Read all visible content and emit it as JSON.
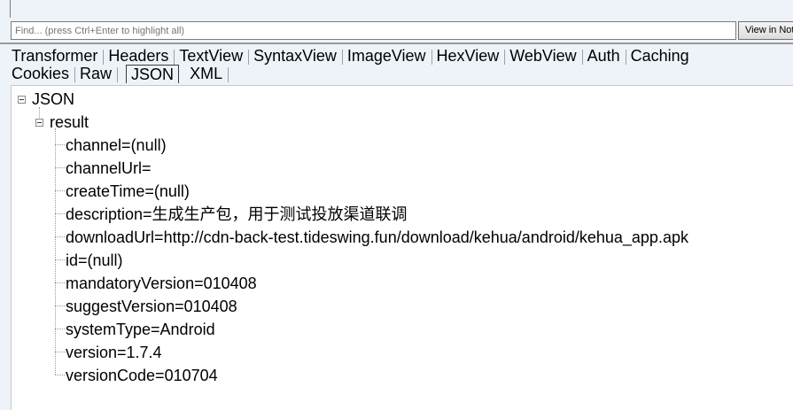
{
  "find": {
    "placeholder": "Find... (press Ctrl+Enter to highlight all)",
    "view_button": "View in Notepad"
  },
  "tabs": {
    "row1": [
      "Transformer",
      "Headers",
      "TextView",
      "SyntaxView",
      "ImageView",
      "HexView",
      "WebView",
      "Auth",
      "Caching"
    ],
    "row2": [
      "Cookies",
      "Raw",
      "JSON",
      "XML"
    ],
    "active": "JSON"
  },
  "tree": {
    "root": "JSON",
    "result": "result",
    "items": [
      "channel=(null)",
      "channelUrl=",
      "createTime=(null)",
      "description=生成生产包，用于测试投放渠道联调",
      "downloadUrl=http://cdn-back-test.tideswing.fun/download/kehua/android/kehua_app.apk",
      "id=(null)",
      "mandatoryVersion=010408",
      "suggestVersion=010408",
      "systemType=Android",
      "version=1.7.4",
      "versionCode=010704"
    ]
  }
}
